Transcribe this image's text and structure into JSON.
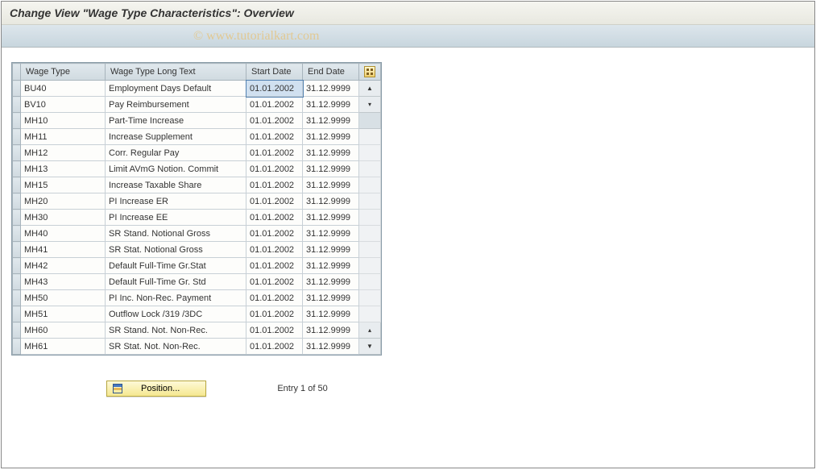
{
  "title": "Change View \"Wage Type Characteristics\": Overview",
  "watermark": "© www.tutorialkart.com",
  "columns": {
    "wage_type": "Wage Type",
    "long_text": "Wage Type Long Text",
    "start_date": "Start Date",
    "end_date": "End Date"
  },
  "rows": [
    {
      "wage_type": "BU40",
      "long_text": "Employment Days Default",
      "start_date": "01.01.2002",
      "end_date": "31.12.9999"
    },
    {
      "wage_type": "BV10",
      "long_text": "Pay Reimbursement",
      "start_date": "01.01.2002",
      "end_date": "31.12.9999"
    },
    {
      "wage_type": "MH10",
      "long_text": "Part-Time Increase",
      "start_date": "01.01.2002",
      "end_date": "31.12.9999"
    },
    {
      "wage_type": "MH11",
      "long_text": "Increase Supplement",
      "start_date": "01.01.2002",
      "end_date": "31.12.9999"
    },
    {
      "wage_type": "MH12",
      "long_text": "Corr. Regular Pay",
      "start_date": "01.01.2002",
      "end_date": "31.12.9999"
    },
    {
      "wage_type": "MH13",
      "long_text": "Limit AVmG Notion. Commit",
      "start_date": "01.01.2002",
      "end_date": "31.12.9999"
    },
    {
      "wage_type": "MH15",
      "long_text": "Increase Taxable Share",
      "start_date": "01.01.2002",
      "end_date": "31.12.9999"
    },
    {
      "wage_type": "MH20",
      "long_text": "PI Increase ER",
      "start_date": "01.01.2002",
      "end_date": "31.12.9999"
    },
    {
      "wage_type": "MH30",
      "long_text": "PI Increase EE",
      "start_date": "01.01.2002",
      "end_date": "31.12.9999"
    },
    {
      "wage_type": "MH40",
      "long_text": "SR Stand. Notional Gross",
      "start_date": "01.01.2002",
      "end_date": "31.12.9999"
    },
    {
      "wage_type": "MH41",
      "long_text": "SR Stat. Notional Gross",
      "start_date": "01.01.2002",
      "end_date": "31.12.9999"
    },
    {
      "wage_type": "MH42",
      "long_text": "Default Full-Time Gr.Stat",
      "start_date": "01.01.2002",
      "end_date": "31.12.9999"
    },
    {
      "wage_type": "MH43",
      "long_text": "Default Full-Time Gr. Std",
      "start_date": "01.01.2002",
      "end_date": "31.12.9999"
    },
    {
      "wage_type": "MH50",
      "long_text": "PI Inc. Non-Rec. Payment",
      "start_date": "01.01.2002",
      "end_date": "31.12.9999"
    },
    {
      "wage_type": "MH51",
      "long_text": "Outflow Lock /319 /3DC",
      "start_date": "01.01.2002",
      "end_date": "31.12.9999"
    },
    {
      "wage_type": "MH60",
      "long_text": "SR Stand. Not. Non-Rec.",
      "start_date": "01.01.2002",
      "end_date": "31.12.9999"
    },
    {
      "wage_type": "MH61",
      "long_text": "SR Stat. Not. Non-Rec.",
      "start_date": "01.01.2002",
      "end_date": "31.12.9999"
    }
  ],
  "footer": {
    "position_button": "Position...",
    "entry_status": "Entry 1 of 50"
  }
}
